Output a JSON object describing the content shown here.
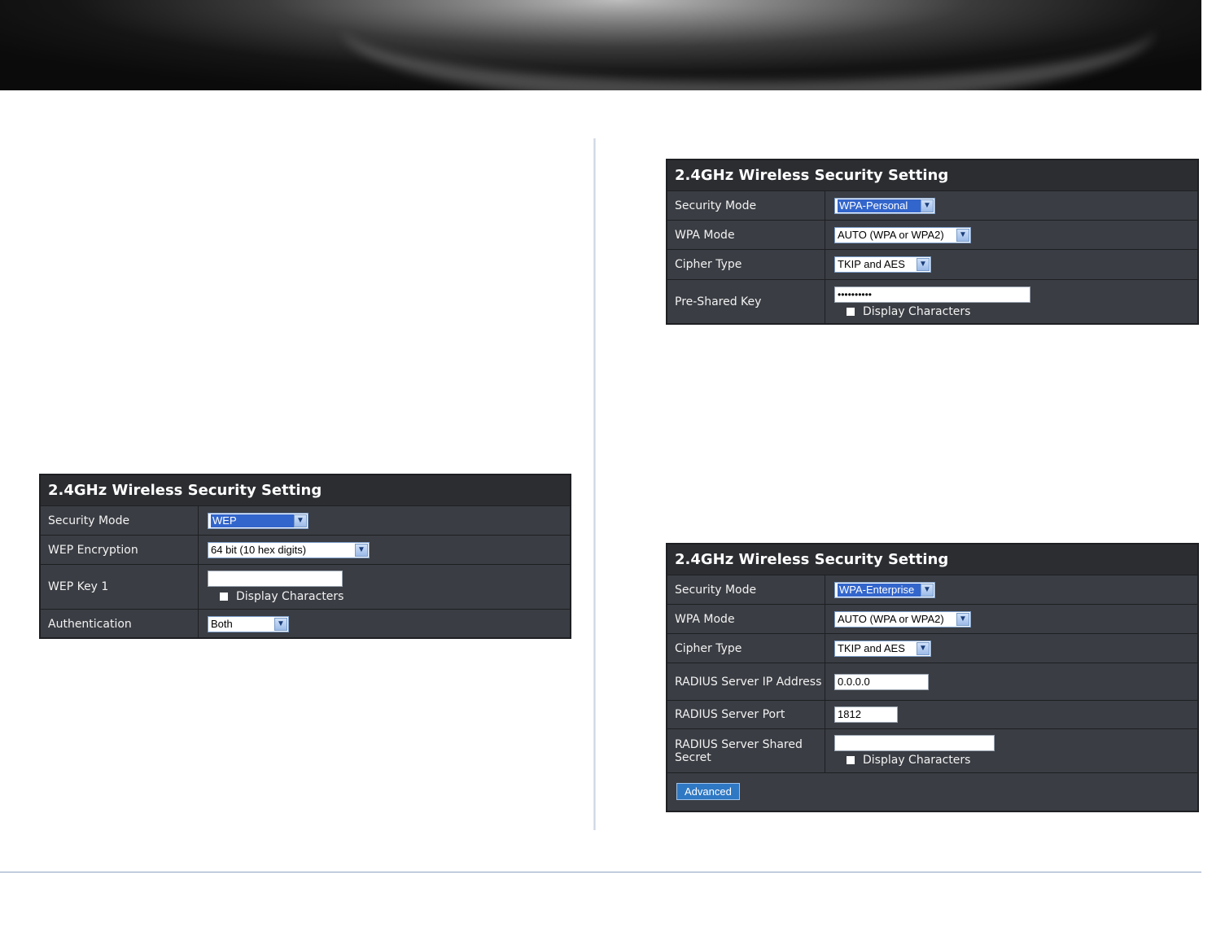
{
  "wep_panel": {
    "title": "2.4GHz Wireless Security Setting",
    "security_mode_label": "Security Mode",
    "security_mode_value": "WEP",
    "wep_encryption_label": "WEP Encryption",
    "wep_encryption_value": "64 bit (10 hex digits)",
    "wep_key_label": "WEP Key 1",
    "wep_key_value": "",
    "display_characters": "Display Characters",
    "authentication_label": "Authentication",
    "authentication_value": "Both"
  },
  "wpa_personal_panel": {
    "title": "2.4GHz Wireless Security Setting",
    "security_mode_label": "Security Mode",
    "security_mode_value": "WPA-Personal",
    "wpa_mode_label": "WPA Mode",
    "wpa_mode_value": "AUTO (WPA or WPA2)",
    "cipher_type_label": "Cipher Type",
    "cipher_type_value": "TKIP and AES",
    "psk_label": "Pre-Shared Key",
    "psk_value": "••••••••••",
    "display_characters": "Display Characters"
  },
  "wpa_enterprise_panel": {
    "title": "2.4GHz Wireless Security Setting",
    "security_mode_label": "Security Mode",
    "security_mode_value": "WPA-Enterprise",
    "wpa_mode_label": "WPA Mode",
    "wpa_mode_value": "AUTO (WPA or WPA2)",
    "cipher_type_label": "Cipher Type",
    "cipher_type_value": "TKIP and AES",
    "radius_ip_label": "RADIUS Server IP Address",
    "radius_ip_value": "0.0.0.0",
    "radius_port_label": "RADIUS Server Port",
    "radius_port_value": "1812",
    "radius_secret_label": "RADIUS Server Shared Secret",
    "radius_secret_value": "",
    "display_characters": "Display Characters",
    "advanced_button": "Advanced"
  },
  "icons": {
    "dropdown_arrow": "chevron-down-icon"
  }
}
